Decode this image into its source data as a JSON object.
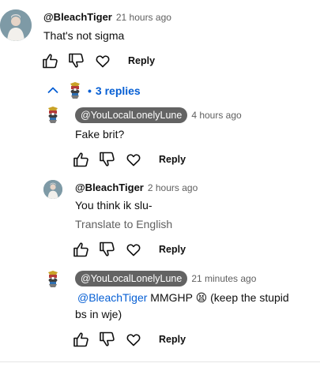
{
  "top_comment": {
    "username": "@BleachTiger",
    "time": "21 hours ago",
    "text": "That's not sigma",
    "reply_label": "Reply"
  },
  "replies_toggle": {
    "dot": "•",
    "label": "3 replies"
  },
  "replies": [
    {
      "username": "@YouLocalLonelyLune",
      "time": "4 hours ago",
      "text": "Fake brit?",
      "reply_label": "Reply"
    },
    {
      "username": "@BleachTiger",
      "time": "2 hours ago",
      "text": "You think ik slu-",
      "translate": "Translate to English",
      "reply_label": "Reply"
    },
    {
      "username": "@YouLocalLonelyLune",
      "time": "21 minutes ago",
      "mention": "@BleachTiger",
      "text_line1": " MMGHP 😫 (keep the stupid",
      "text_line2": "bs in wje)",
      "reply_label": "Reply"
    }
  ],
  "icons": {
    "like": "thumbs-up-icon",
    "dislike": "thumbs-down-icon",
    "heart": "heart-icon",
    "collapse": "chevron-up-icon"
  },
  "colors": {
    "link_blue": "#065fd4",
    "chip_bg": "#636363",
    "muted_text": "#606060"
  }
}
